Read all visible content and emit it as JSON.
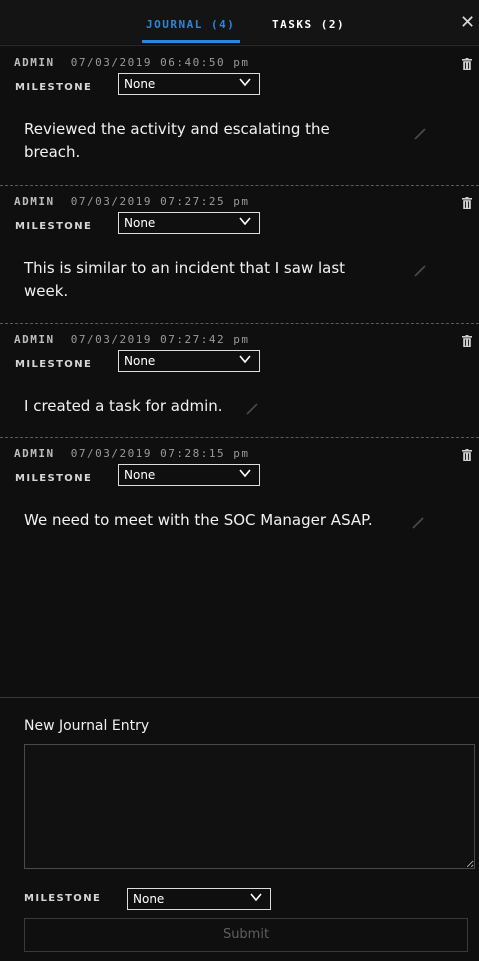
{
  "tabs": [
    {
      "label": "JOURNAL (4)",
      "active": true
    },
    {
      "label": "TASKS (2)",
      "active": false
    }
  ],
  "close_symbol": "✕",
  "milestone_label": "MILESTONE",
  "entries": [
    {
      "user": "ADMIN",
      "timestamp": "07/03/2019 06:40:50 pm",
      "milestone": "None",
      "text": "Reviewed the activity and escalating the breach."
    },
    {
      "user": "ADMIN",
      "timestamp": "07/03/2019 07:27:25 pm",
      "milestone": "None",
      "text": "This is similar to an incident that I saw last week."
    },
    {
      "user": "ADMIN",
      "timestamp": "07/03/2019 07:27:42 pm",
      "milestone": "None",
      "text": "I created a task for admin."
    },
    {
      "user": "ADMIN",
      "timestamp": "07/03/2019 07:28:15 pm",
      "milestone": "None",
      "text": "We need to meet with the SOC Manager ASAP."
    }
  ],
  "composer": {
    "title": "New Journal Entry",
    "text_value": "",
    "milestone_label": "MILESTONE",
    "milestone_value": "None",
    "submit_label": "Submit"
  },
  "icons": {
    "close": "close-icon",
    "trash": "trash-icon",
    "edit": "pencil-icon",
    "dropdown": "chevron-down-icon"
  },
  "colors": {
    "background": "#0f0f0f",
    "accent": "#2e86d6",
    "text": "#f2f2f2",
    "muted": "#9a9a9a"
  }
}
